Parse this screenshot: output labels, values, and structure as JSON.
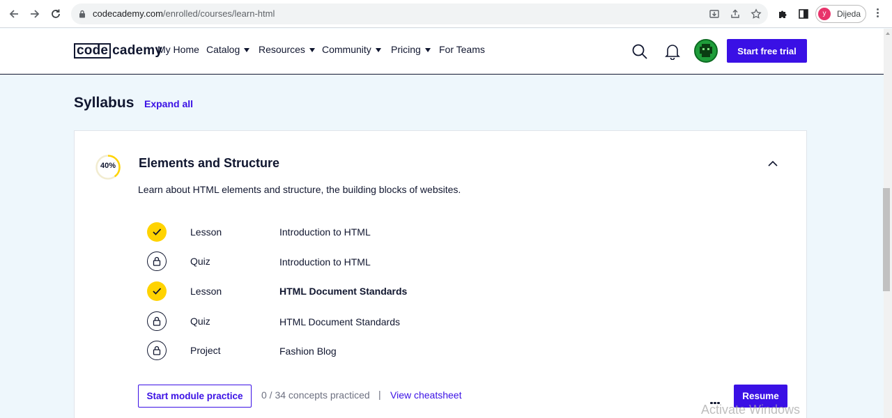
{
  "browser": {
    "url_host": "codecademy.com",
    "url_path": "/enrolled/courses/learn-html",
    "profile_initial": "y",
    "profile_name": "Dijeda"
  },
  "header": {
    "logo_box": "code",
    "logo_rest": "cademy",
    "nav": [
      {
        "label": "My Home"
      },
      {
        "label": "Catalog"
      },
      {
        "label": "Resources"
      },
      {
        "label": "Community"
      },
      {
        "label": "Pricing"
      },
      {
        "label": "For Teams"
      }
    ],
    "cta_label": "Start free trial"
  },
  "syllabus": {
    "title": "Syllabus",
    "expand_label": "Expand all"
  },
  "module": {
    "progress_label": "40%",
    "progress_fraction": 0.4,
    "title": "Elements and Structure",
    "description": "Learn about HTML elements and structure, the building blocks of websites.",
    "items": [
      {
        "type": "Lesson",
        "title": "Introduction to HTML",
        "status": "complete"
      },
      {
        "type": "Quiz",
        "title": "Introduction to HTML",
        "status": "locked"
      },
      {
        "type": "Lesson",
        "title": "HTML Document Standards",
        "status": "complete"
      },
      {
        "type": "Quiz",
        "title": "HTML Document Standards",
        "status": "locked"
      },
      {
        "type": "Project",
        "title": "Fashion Blog",
        "status": "locked"
      }
    ],
    "practice_label": "Start module practice",
    "concepts_text": "0 / 34 concepts practiced",
    "separator": "|",
    "cheatsheet_label": "View cheatsheet",
    "resume_label": "Resume"
  },
  "watermark": "Activate Windows",
  "colors": {
    "accent": "#3a10e5",
    "complete": "#ffd300",
    "page_bg": "#eef7fc",
    "text": "#10162f"
  }
}
